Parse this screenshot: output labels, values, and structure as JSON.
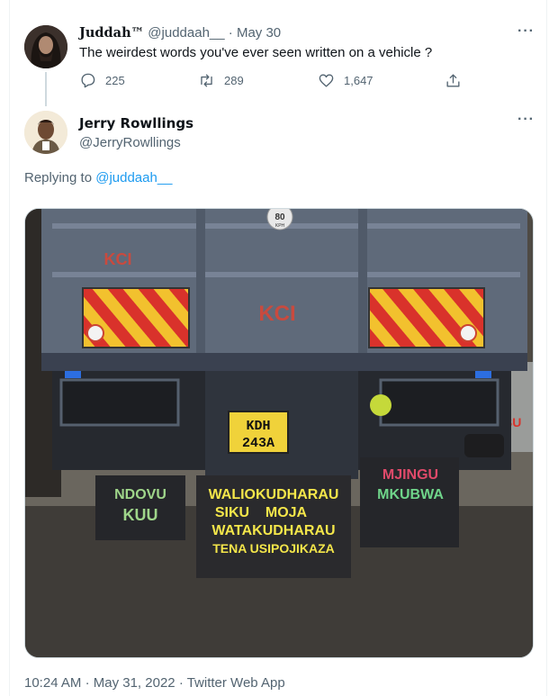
{
  "tweet1": {
    "display_name": "Juddah™",
    "handle": "@juddaah__",
    "separator": "·",
    "date": "May 30",
    "text": "The weirdest words you've ever seen written on a vehicle ?",
    "more_label": "···",
    "actions": {
      "replies": "225",
      "retweets": "289",
      "likes": "1,647"
    },
    "icons": [
      "reply-icon",
      "retweet-icon",
      "like-icon",
      "share-icon"
    ]
  },
  "tweet2": {
    "display_name": "Jerry Rowllings",
    "handle": "@JerryRowllings",
    "more_label": "···",
    "replying_prefix": "Replying to",
    "replying_handle": "@juddaah__",
    "media": {
      "speed_badge_top": "80",
      "speed_badge_bottom": "KPH",
      "brand_top": "KCI",
      "brand_center": "KCI",
      "plate_line1": "KDH",
      "plate_line2": "243A",
      "mudflap_left_line1": "NDOVU",
      "mudflap_left_line2": "KUU",
      "mudflap_center_line1": "WALIOKUDHARAU",
      "mudflap_center_line2": "SIKU    MOJA",
      "mudflap_center_line3": "WATAKUDHARAU",
      "mudflap_center_line4": "TENA USIPOJIKAZA",
      "mudflap_right_line1": "MJINGU",
      "mudflap_right_line2": "MKUBWA",
      "background_truck_text": "ISU"
    },
    "footer": {
      "time": "10:24 AM",
      "date": "May 31, 2022",
      "source": "Twitter Web App",
      "separator": "·"
    }
  },
  "colors": {
    "link": "#1d9bf0",
    "muted": "#536471",
    "text": "#0f1419"
  }
}
